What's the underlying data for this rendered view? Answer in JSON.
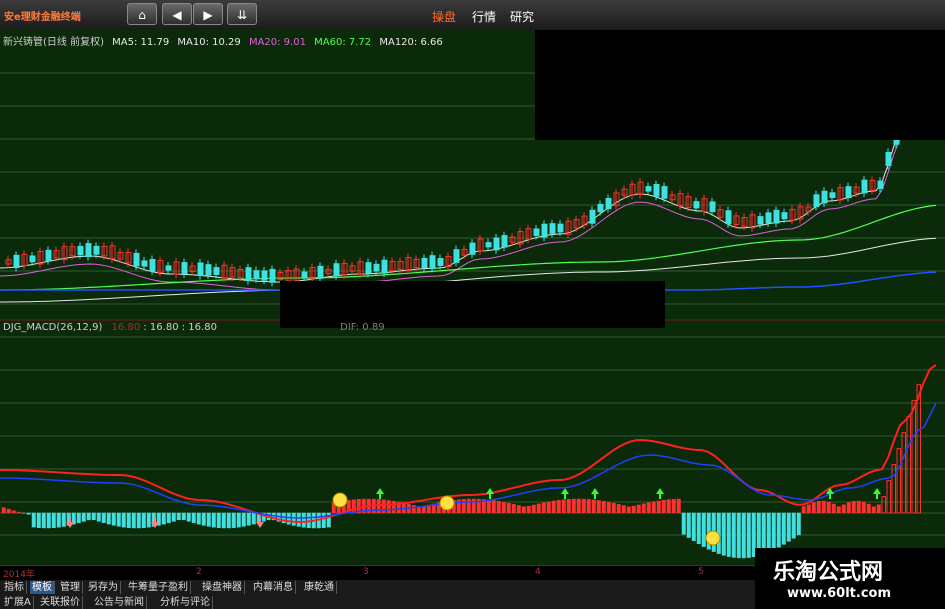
{
  "app": {
    "logo": "安e理财金融终端"
  },
  "nav": {
    "home": "⌂",
    "back": "◀",
    "forward": "▶",
    "down": "⇊"
  },
  "menu": [
    {
      "label": "操盘",
      "active": true
    },
    {
      "label": "行情",
      "active": false
    },
    {
      "label": "研究",
      "active": false
    }
  ],
  "stock": {
    "name": "新兴铸管(日线 前复权)",
    "ma": [
      {
        "label": "MA5: 11.79",
        "color": "#e8e8e8"
      },
      {
        "label": "MA10: 10.29",
        "color": "#e8e8e8"
      },
      {
        "label": "MA20: 9.01",
        "color": "#e060e0"
      },
      {
        "label": "MA60: 7.72",
        "color": "#50ff50"
      },
      {
        "label": "MA120: 6.66",
        "color": "#e8e8e8"
      }
    ]
  },
  "macd": {
    "title": "DJG_MACD(26,12,9)",
    "v1": "16.80",
    "v2": ": 16.80",
    "v3": ": 16.80",
    "dif": "DIF: 0.89"
  },
  "date_axis": [
    {
      "label": "2014年"
    },
    {
      "label": "2"
    },
    {
      "label": "3"
    },
    {
      "label": "4"
    },
    {
      "label": "5"
    }
  ],
  "tabs_row1": [
    {
      "label": "指标",
      "active": false
    },
    {
      "label": "模板",
      "active": true
    },
    {
      "label": "管理",
      "active": false
    },
    {
      "label": "另存为",
      "active": false
    },
    {
      "label": "牛筹量子盈利",
      "active": false
    },
    {
      "label": "操盘神器",
      "active": false
    },
    {
      "label": "内幕消息",
      "active": false
    },
    {
      "label": "康乾通",
      "active": false
    }
  ],
  "tabs_row2": [
    {
      "label": "扩展A"
    },
    {
      "label": "关联报价"
    },
    {
      "label": "公告与新闻"
    },
    {
      "label": "分析与评论"
    }
  ],
  "watermark": {
    "title": "乐淘公式网",
    "url": "www.60lt.com"
  },
  "colors": {
    "up": "#ff3030",
    "down": "#40e0e0",
    "ma_white": "#e8e8e8",
    "ma_magenta": "#e060e0",
    "ma_green": "#50ff50",
    "ma_blue": "#2050ff",
    "macd_line": "#ff2020",
    "signal_line": "#2040ff"
  }
}
